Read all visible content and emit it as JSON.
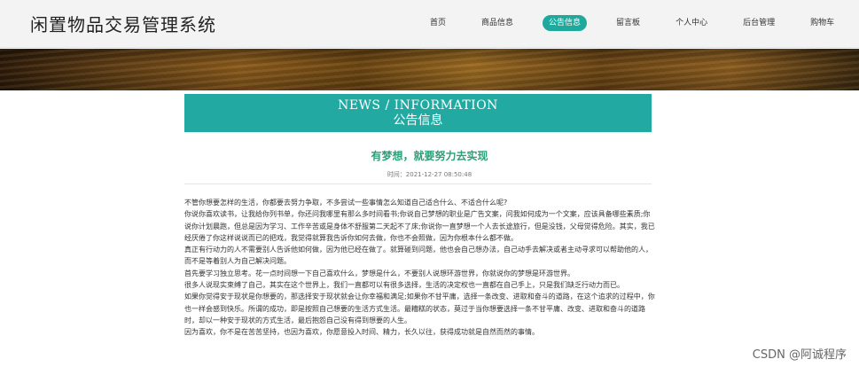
{
  "header": {
    "site_title": "闲置物品交易管理系统",
    "nav": [
      {
        "label": "首页",
        "active": false
      },
      {
        "label": "商品信息",
        "active": false
      },
      {
        "label": "公告信息",
        "active": true
      },
      {
        "label": "留言板",
        "active": false
      },
      {
        "label": "个人中心",
        "active": false
      },
      {
        "label": "后台管理",
        "active": false
      },
      {
        "label": "购物车",
        "active": false
      }
    ]
  },
  "section": {
    "title_en": "NEWS / INFORMATION",
    "title_cn": "公告信息"
  },
  "article": {
    "title": "有梦想，就要努力去实现",
    "time": "时间：2021-12-27 08:50:48",
    "paragraphs": [
      "不管你想要怎样的生活，你都要去努力争取，不多尝试一些事情怎么知道自己适合什么、不适合什么呢?",
      "你说你喜欢读书，让我给你列书单，你还问我哪里有那么多时间看书;你说自己梦想的职业是广告文案，问我如何成为一个文案，应该具备哪些素质;你说你计划晨跑，但总是因为学习、工作辛苦或是身体不舒服第二天起不了床;你说你一直梦想一个人去长途旅行，但是没钱，父母觉得危险。其实，我已经厌倦了你这样说说而已的把戏，我觉得就算我告诉你如何去做，你也不会照做，因为你根本什么都不做。",
      "真正有行动力的人不需要别人告诉他如何做，因为他已经在做了。就算碰到问题，他也会自己想办法，自己动手去解决或者主动寻求可以帮助他的人，而不是等着别人为自己解决问题。",
      "首先要学习独立思考。花一点时间想一下自己喜欢什么，梦想是什么，不要别人说想环游世界，你就说你的梦想是环游世界。",
      "很多人说现实束缚了自己，其实在这个世界上，我们一直都可以有很多选择，生活的决定权也一直都在自己手上，只是我们缺乏行动力而已。",
      "如果你觉得安于现状是你想要的，那选择安于现状就会让你幸福和满足;如果你不甘平庸，选择一条改变、进取和奋斗的道路，在这个追求的过程中，你也一样会感到快乐。所谓的成功，即是按照自己想要的生活方式生活。最糟糕的状态，莫过于当你想要选择一条不甘平庸、改变、进取和奋斗的道路时，却以一种安于现状的方式生活，最后抱怨自己没有得到想要的人生。",
      "因为喜欢，你不是在苦苦坚持，也因为喜欢，你愿意投入时间、精力，长久以往，获得成功就是自然而然的事情。"
    ]
  },
  "watermark": "CSDN @阿诚程序",
  "colors": {
    "accent": "#22aaa2",
    "article_title": "#2c9f7a"
  }
}
